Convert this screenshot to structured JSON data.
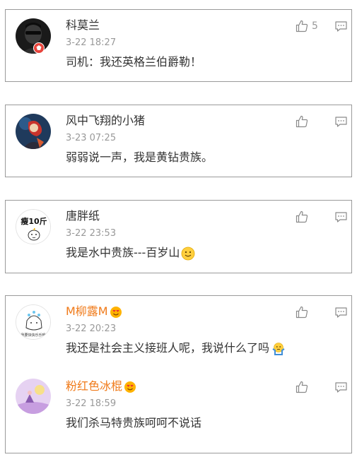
{
  "comments": [
    {
      "name": "科莫兰",
      "time": "3-22 18:27",
      "text": "司机：我还英格兰伯爵勒！",
      "likes": "5"
    },
    {
      "name": "风中飞翔的小猪",
      "time": "3-23 07:25",
      "text": "弱弱说一声，我是黄钻贵族。"
    },
    {
      "name": "唐胖纸",
      "avatar_text": "瘦10斤",
      "time": "3-22 23:53",
      "text": "我是水中贵族---百岁山"
    },
    {
      "name": "M柳露M",
      "time": "3-22 20:23",
      "text": "我还是社会主义接班人呢，我说什么了吗",
      "avatar_caption": "我要快快乐乐哦!"
    },
    {
      "name": "粉红色冰棍",
      "time": "3-22 18:59",
      "text": "我们杀马特贵族呵呵不说话"
    }
  ],
  "colors": {
    "vip_name": "#f07a19",
    "border": "#9a9a9a",
    "meta": "#999999",
    "text": "#333333"
  },
  "icons": {
    "like": "thumbs-up-icon",
    "reply": "comment-icon",
    "verified": "red-v-badge-icon",
    "vip": "heart-eyes-vip-icon"
  }
}
